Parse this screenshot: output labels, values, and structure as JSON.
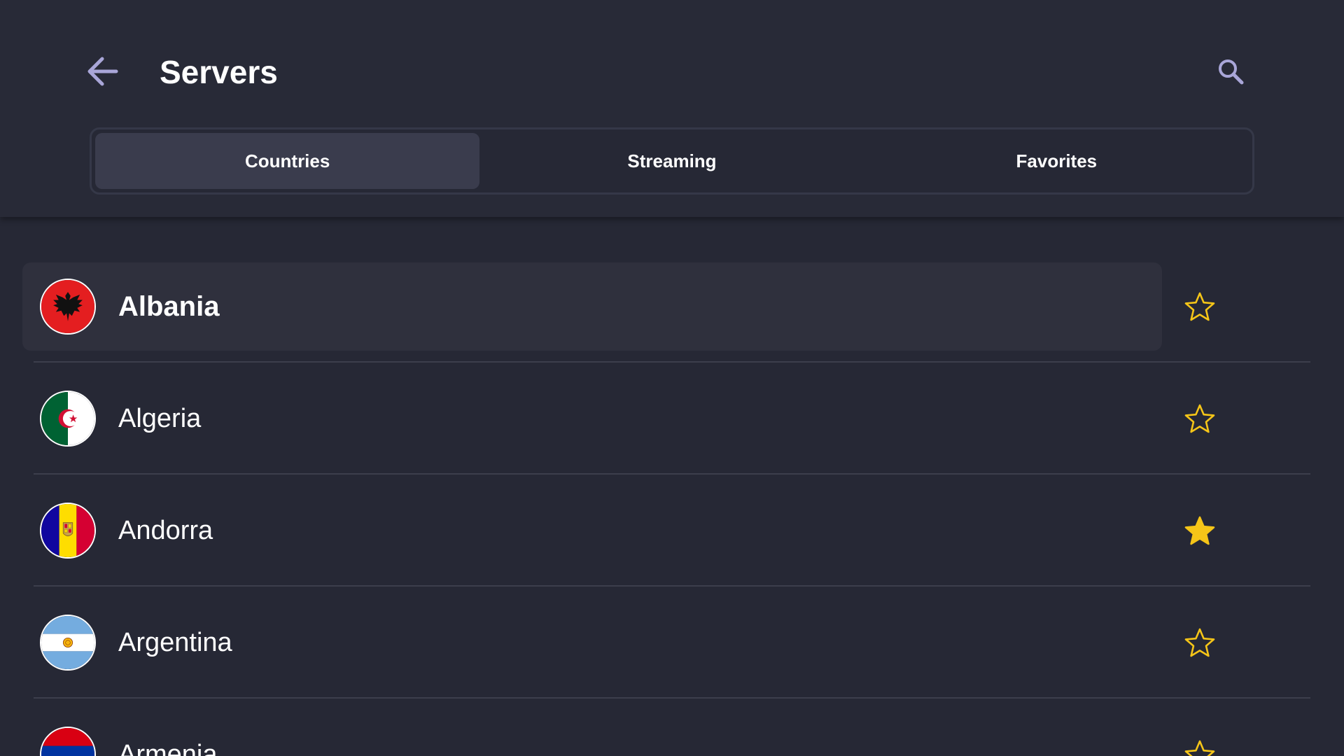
{
  "header": {
    "title": "Servers",
    "back_icon": "arrow-left-icon",
    "search_icon": "search-icon"
  },
  "tabs": [
    {
      "label": "Countries",
      "active": true
    },
    {
      "label": "Streaming",
      "active": false
    },
    {
      "label": "Favorites",
      "active": false
    }
  ],
  "countries": [
    {
      "name": "Albania",
      "flag": "albania-flag",
      "favorite": false,
      "focused": true
    },
    {
      "name": "Algeria",
      "flag": "algeria-flag",
      "favorite": false,
      "focused": false
    },
    {
      "name": "Andorra",
      "flag": "andorra-flag",
      "favorite": true,
      "focused": false
    },
    {
      "name": "Argentina",
      "flag": "argentina-flag",
      "favorite": false,
      "focused": false
    },
    {
      "name": "Armenia",
      "flag": "armenia-flag",
      "favorite": false,
      "focused": false
    }
  ],
  "colors": {
    "background": "#262835",
    "star": "#f5c518",
    "accent_text": "#ffffff"
  }
}
